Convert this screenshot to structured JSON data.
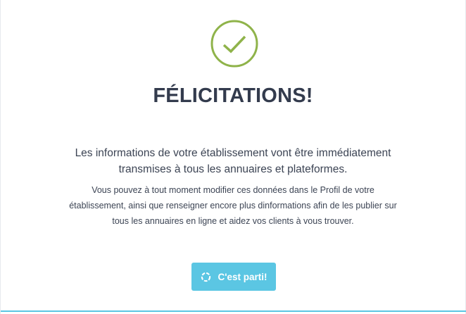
{
  "colors": {
    "accent": "#5bc6e3",
    "success": "#8fb34a",
    "text": "#333b4d"
  },
  "icons": {
    "success": "check-circle-icon",
    "loading": "spinner-icon"
  },
  "dialog": {
    "title": "FÉLICITATIONS!",
    "lead": "Les informations de votre établissement vont être immédiatement transmises à tous les annuaires et plateformes.",
    "details": "Vous pouvez à tout moment modifier ces données dans le Profil de votre établissement, ainsi que renseigner encore plus dinformations afin de les publier sur tous les annuaires en ligne et aidez vos clients à vous trouver.",
    "button_label": "C'est parti!"
  }
}
